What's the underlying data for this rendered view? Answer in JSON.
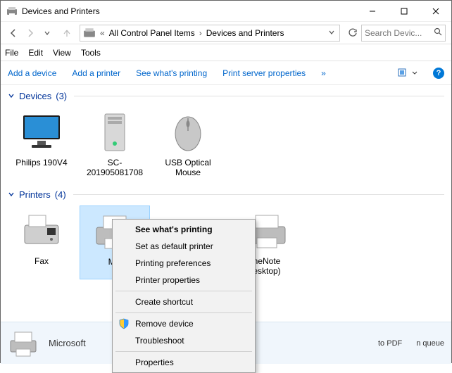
{
  "window": {
    "title": "Devices and Printers"
  },
  "address": {
    "crumbs": [
      "All Control Panel Items",
      "Devices and Printers"
    ]
  },
  "search": {
    "placeholder": "Search Devic..."
  },
  "menubar": {
    "file": "File",
    "edit": "Edit",
    "view": "View",
    "tools": "Tools"
  },
  "toolbar": {
    "add_device": "Add a device",
    "add_printer": "Add a printer",
    "see_printing": "See what's printing",
    "print_server": "Print server properties"
  },
  "groups": {
    "devices": {
      "title": "Devices",
      "count": "(3)"
    },
    "printers": {
      "title": "Printers",
      "count": "(4)"
    }
  },
  "devices": [
    {
      "label": "Philips 190V4"
    },
    {
      "label": "SC-201905081708"
    },
    {
      "label": "USB Optical Mouse"
    }
  ],
  "printers": [
    {
      "label": "Fax"
    },
    {
      "label": "Mic"
    },
    {
      "label_prefix": "neNote",
      "label_suffix": "esktop)"
    }
  ],
  "context_menu": {
    "see_printing": "See what's printing",
    "set_default": "Set as default printer",
    "printing_prefs": "Printing preferences",
    "printer_props": "Printer properties",
    "create_shortcut": "Create shortcut",
    "remove_device": "Remove device",
    "troubleshoot": "Troubleshoot",
    "properties": "Properties"
  },
  "status": {
    "name": "Microsoft",
    "state_value": "to PDF",
    "queue_value": "n queue"
  }
}
